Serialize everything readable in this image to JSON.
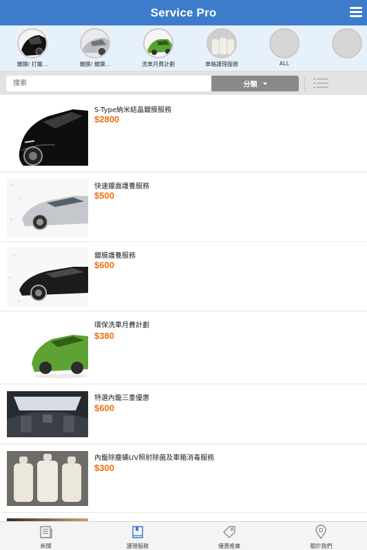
{
  "header": {
    "title": "Service Pro",
    "menu_icon": "hamburger-menu-icon"
  },
  "categories": [
    {
      "label": "鍍膜/ 打蠟...",
      "image": "black-car-wrap"
    },
    {
      "label": "鍍膜/ 鍍膜...",
      "image": "silver-car-detail"
    },
    {
      "label": "洗車月費計劃",
      "image": "green-grass-car"
    },
    {
      "label": "車箱護理服務",
      "image": "car-interior-seats"
    },
    {
      "label": "ALL",
      "image": ""
    },
    {
      "label": "",
      "image": ""
    }
  ],
  "search": {
    "placeholder": "搜索",
    "category_label": "分類",
    "list_view_icon": "list-view-icon"
  },
  "products": [
    {
      "name": "S-Type納米結晶鍍膜服務",
      "price": "$2800",
      "image": "black-sports-car-front"
    },
    {
      "name": "快速鑞面護養服務",
      "price": "$500",
      "image": "silver-sedan-side"
    },
    {
      "name": "鍍膜護養服務",
      "price": "$600",
      "image": "black-sedan-side"
    },
    {
      "name": "環保洗車月費計劃",
      "price": "$380",
      "image": "grass-covered-car"
    },
    {
      "name": "特選內籠三重優惠",
      "price": "$600",
      "image": "car-interior-dashboard"
    },
    {
      "name": "內籠除塵蟎UV照射除菌及車箱消毒服務",
      "price": "$300",
      "image": "white-leather-seats"
    },
    {
      "name": "",
      "price": "",
      "image": "partial-item"
    }
  ],
  "bottom_nav": [
    {
      "label": "新聞",
      "icon": "newspaper-icon"
    },
    {
      "label": "護理服務",
      "icon": "book-icon"
    },
    {
      "label": "優惠推廣",
      "icon": "tag-icon"
    },
    {
      "label": "關於我們",
      "icon": "location-pin-icon"
    }
  ],
  "colors": {
    "header": "#3c7ccb",
    "price": "#ef6d13",
    "active_nav": "#3c7ccb"
  }
}
